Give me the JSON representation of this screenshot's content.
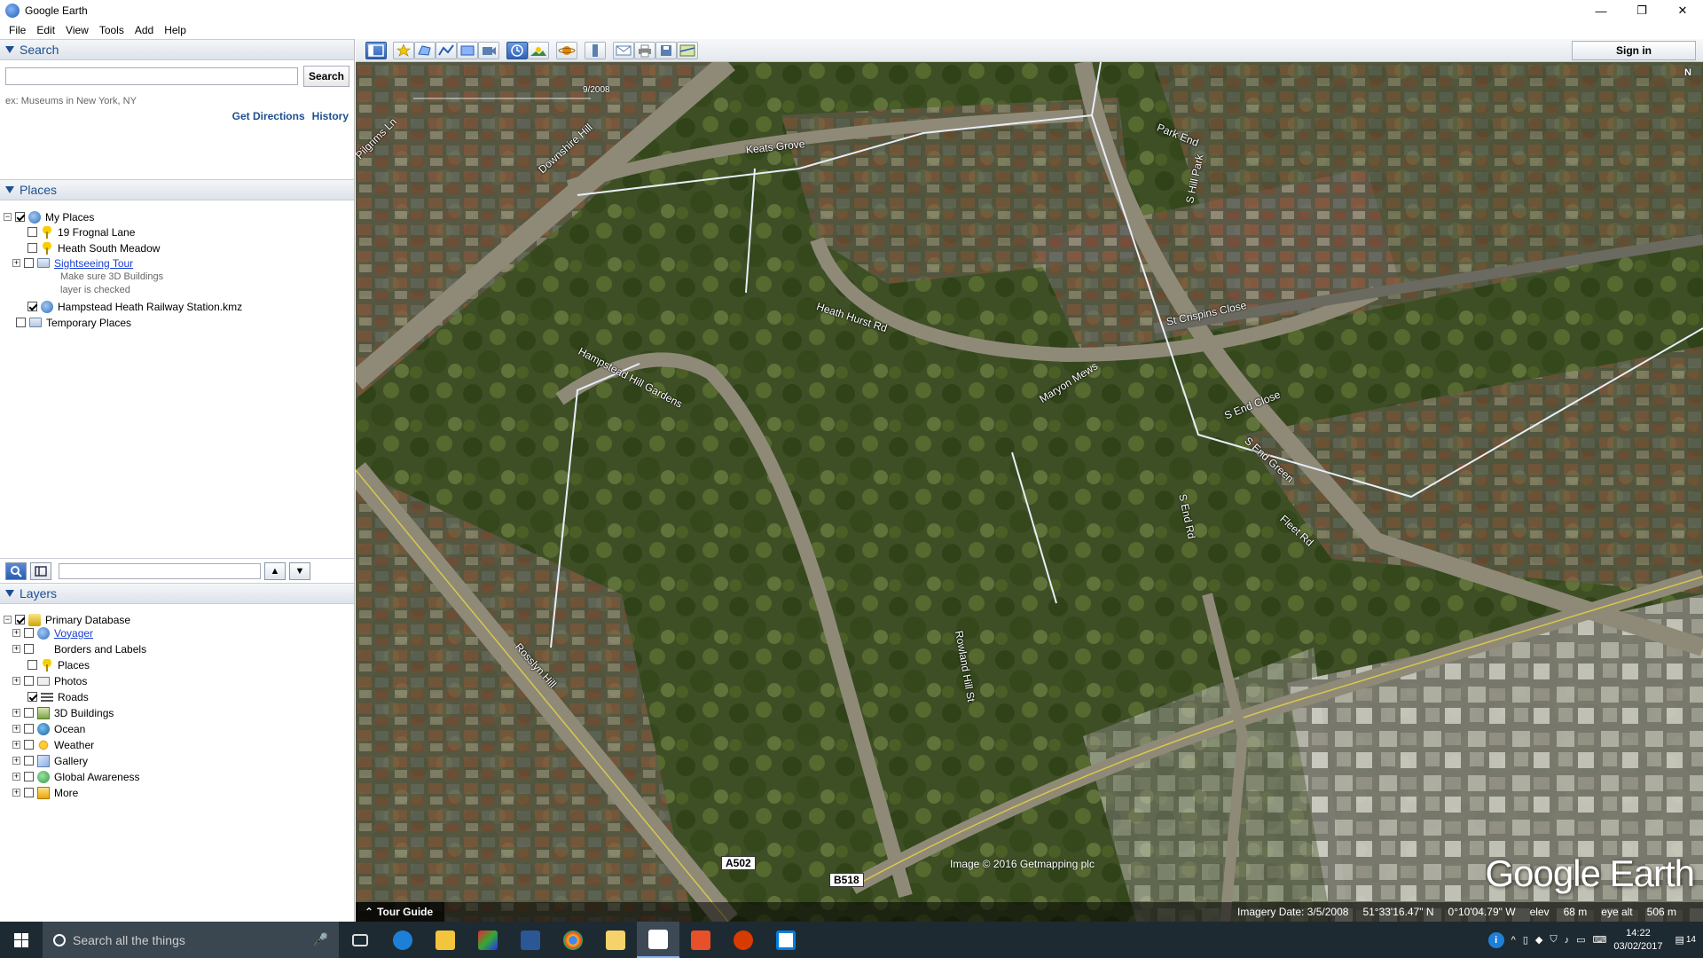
{
  "window": {
    "title": "Google Earth",
    "minimize": "—",
    "maximize": "❐",
    "close": "✕"
  },
  "menu": [
    "File",
    "Edit",
    "View",
    "Tools",
    "Add",
    "Help"
  ],
  "search": {
    "header": "Search",
    "button": "Search",
    "hint": "ex: Museums in New York, NY",
    "get_directions": "Get Directions",
    "history": "History"
  },
  "places": {
    "header": "Places",
    "my_places": "My Places",
    "item1": "19 Frognal Lane",
    "item2": "Heath South Meadow",
    "item3": "Sightseeing Tour",
    "item3_note1": "Make sure 3D Buildings",
    "item3_note2": "layer is checked",
    "item4": "Hampstead Heath Railway Station.kmz",
    "temporary": "Temporary Places"
  },
  "layers": {
    "header": "Layers",
    "primary": "Primary Database",
    "items": [
      "Voyager",
      "Borders and Labels",
      "Places",
      "Photos",
      "Roads",
      "3D Buildings",
      "Ocean",
      "Weather",
      "Gallery",
      "Global Awareness",
      "More"
    ]
  },
  "toolbar": {
    "sign_in": "Sign in"
  },
  "map": {
    "date_marker": "9/2008",
    "compass": "N",
    "labels": [
      "Downshire Hill",
      "Keats Grove",
      "Park End",
      "S Hill Park",
      "Heath Hurst Rd",
      "Hampstead Hill Gardens",
      "St Crispins Close",
      "Maryon Mews",
      "S End Close",
      "S End Green",
      "S End Rd",
      "Fleet Rd",
      "Rosslyn Hill",
      "Rowland Hill St",
      "Pilgrims Ln"
    ],
    "shield1": "A502",
    "shield2": "B518",
    "credit": "Image © 2016 Getmapping plc",
    "watermark": "Google Earth",
    "tour_guide": "Tour Guide",
    "imagery_date": "Imagery Date: 3/5/2008",
    "lat": "51°33'16.47\" N",
    "lon": "0°10'04.79\" W",
    "elev_label": "elev",
    "elev": "68 m",
    "eye_label": "eye alt",
    "eye": "506 m"
  },
  "taskbar": {
    "search_placeholder": "Search all the things",
    "time": "14:22",
    "date": "03/02/2017",
    "notif_count": "14"
  }
}
